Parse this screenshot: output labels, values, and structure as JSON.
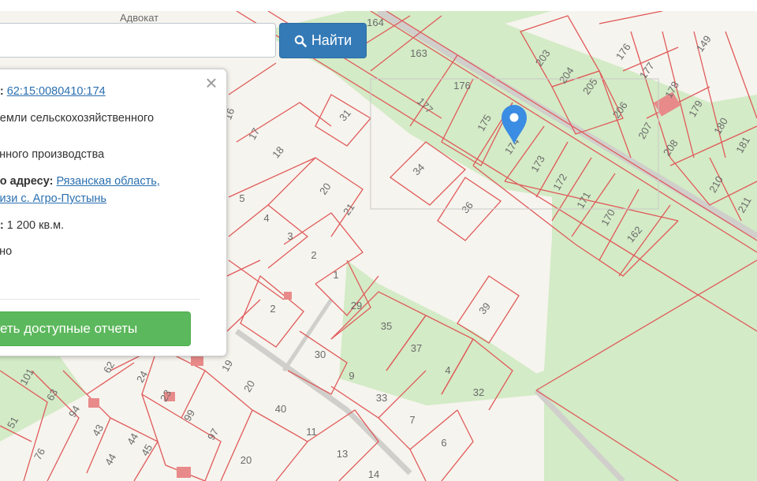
{
  "map": {
    "street_label": "Адвокат",
    "accent_color": "#e05a5a",
    "green_color": "#d3ebc6",
    "marker_color": "#3b8ce3",
    "parcels": [
      {
        "n": "164"
      },
      {
        "n": "163"
      },
      {
        "n": "176"
      },
      {
        "n": "177"
      },
      {
        "n": "175"
      },
      {
        "n": "174"
      },
      {
        "n": "173"
      },
      {
        "n": "172"
      },
      {
        "n": "171"
      },
      {
        "n": "170"
      },
      {
        "n": "162"
      },
      {
        "n": "34"
      },
      {
        "n": "36"
      },
      {
        "n": "31"
      },
      {
        "n": "39"
      },
      {
        "n": "203"
      },
      {
        "n": "204"
      },
      {
        "n": "205"
      },
      {
        "n": "176"
      },
      {
        "n": "177"
      },
      {
        "n": "178"
      },
      {
        "n": "179"
      },
      {
        "n": "180"
      },
      {
        "n": "181"
      },
      {
        "n": "206"
      },
      {
        "n": "207"
      },
      {
        "n": "208"
      },
      {
        "n": "210"
      },
      {
        "n": "211"
      },
      {
        "n": "149"
      },
      {
        "n": "16"
      },
      {
        "n": "17"
      },
      {
        "n": "18"
      },
      {
        "n": "20"
      },
      {
        "n": "21"
      },
      {
        "n": "5"
      },
      {
        "n": "4"
      },
      {
        "n": "3"
      },
      {
        "n": "2"
      },
      {
        "n": "1"
      },
      {
        "n": "2"
      },
      {
        "n": "29"
      },
      {
        "n": "30"
      },
      {
        "n": "35"
      },
      {
        "n": "37"
      },
      {
        "n": "4"
      },
      {
        "n": "9"
      },
      {
        "n": "33"
      },
      {
        "n": "32"
      },
      {
        "n": "7"
      },
      {
        "n": "6"
      },
      {
        "n": "40"
      },
      {
        "n": "11"
      },
      {
        "n": "13"
      },
      {
        "n": "20"
      },
      {
        "n": "14"
      },
      {
        "n": "19"
      },
      {
        "n": "20"
      },
      {
        "n": "97"
      },
      {
        "n": "99"
      },
      {
        "n": "23"
      },
      {
        "n": "24"
      },
      {
        "n": "62"
      },
      {
        "n": "94"
      },
      {
        "n": "43"
      },
      {
        "n": "44"
      },
      {
        "n": "45"
      },
      {
        "n": "44"
      },
      {
        "n": "63"
      },
      {
        "n": "101"
      },
      {
        "n": "51"
      },
      {
        "n": "76"
      }
    ]
  },
  "search": {
    "value": "",
    "placeholder": "",
    "button_label": "Найти"
  },
  "popup": {
    "cad_key": "о:",
    "cad_number": "62:15:0080410:174",
    "category_value_line1": "Земли сельскохозяйственного",
    "use_line": "енного производства",
    "address_key": "по адресу:",
    "address_line1": "Рязанская область,",
    "address_line2": "лизи с. Агро-Пустынь",
    "area_key": "ь:",
    "area_value": "1 200 кв.м.",
    "status_line": "ено",
    "reports_button": "еть доступные отчеты"
  }
}
